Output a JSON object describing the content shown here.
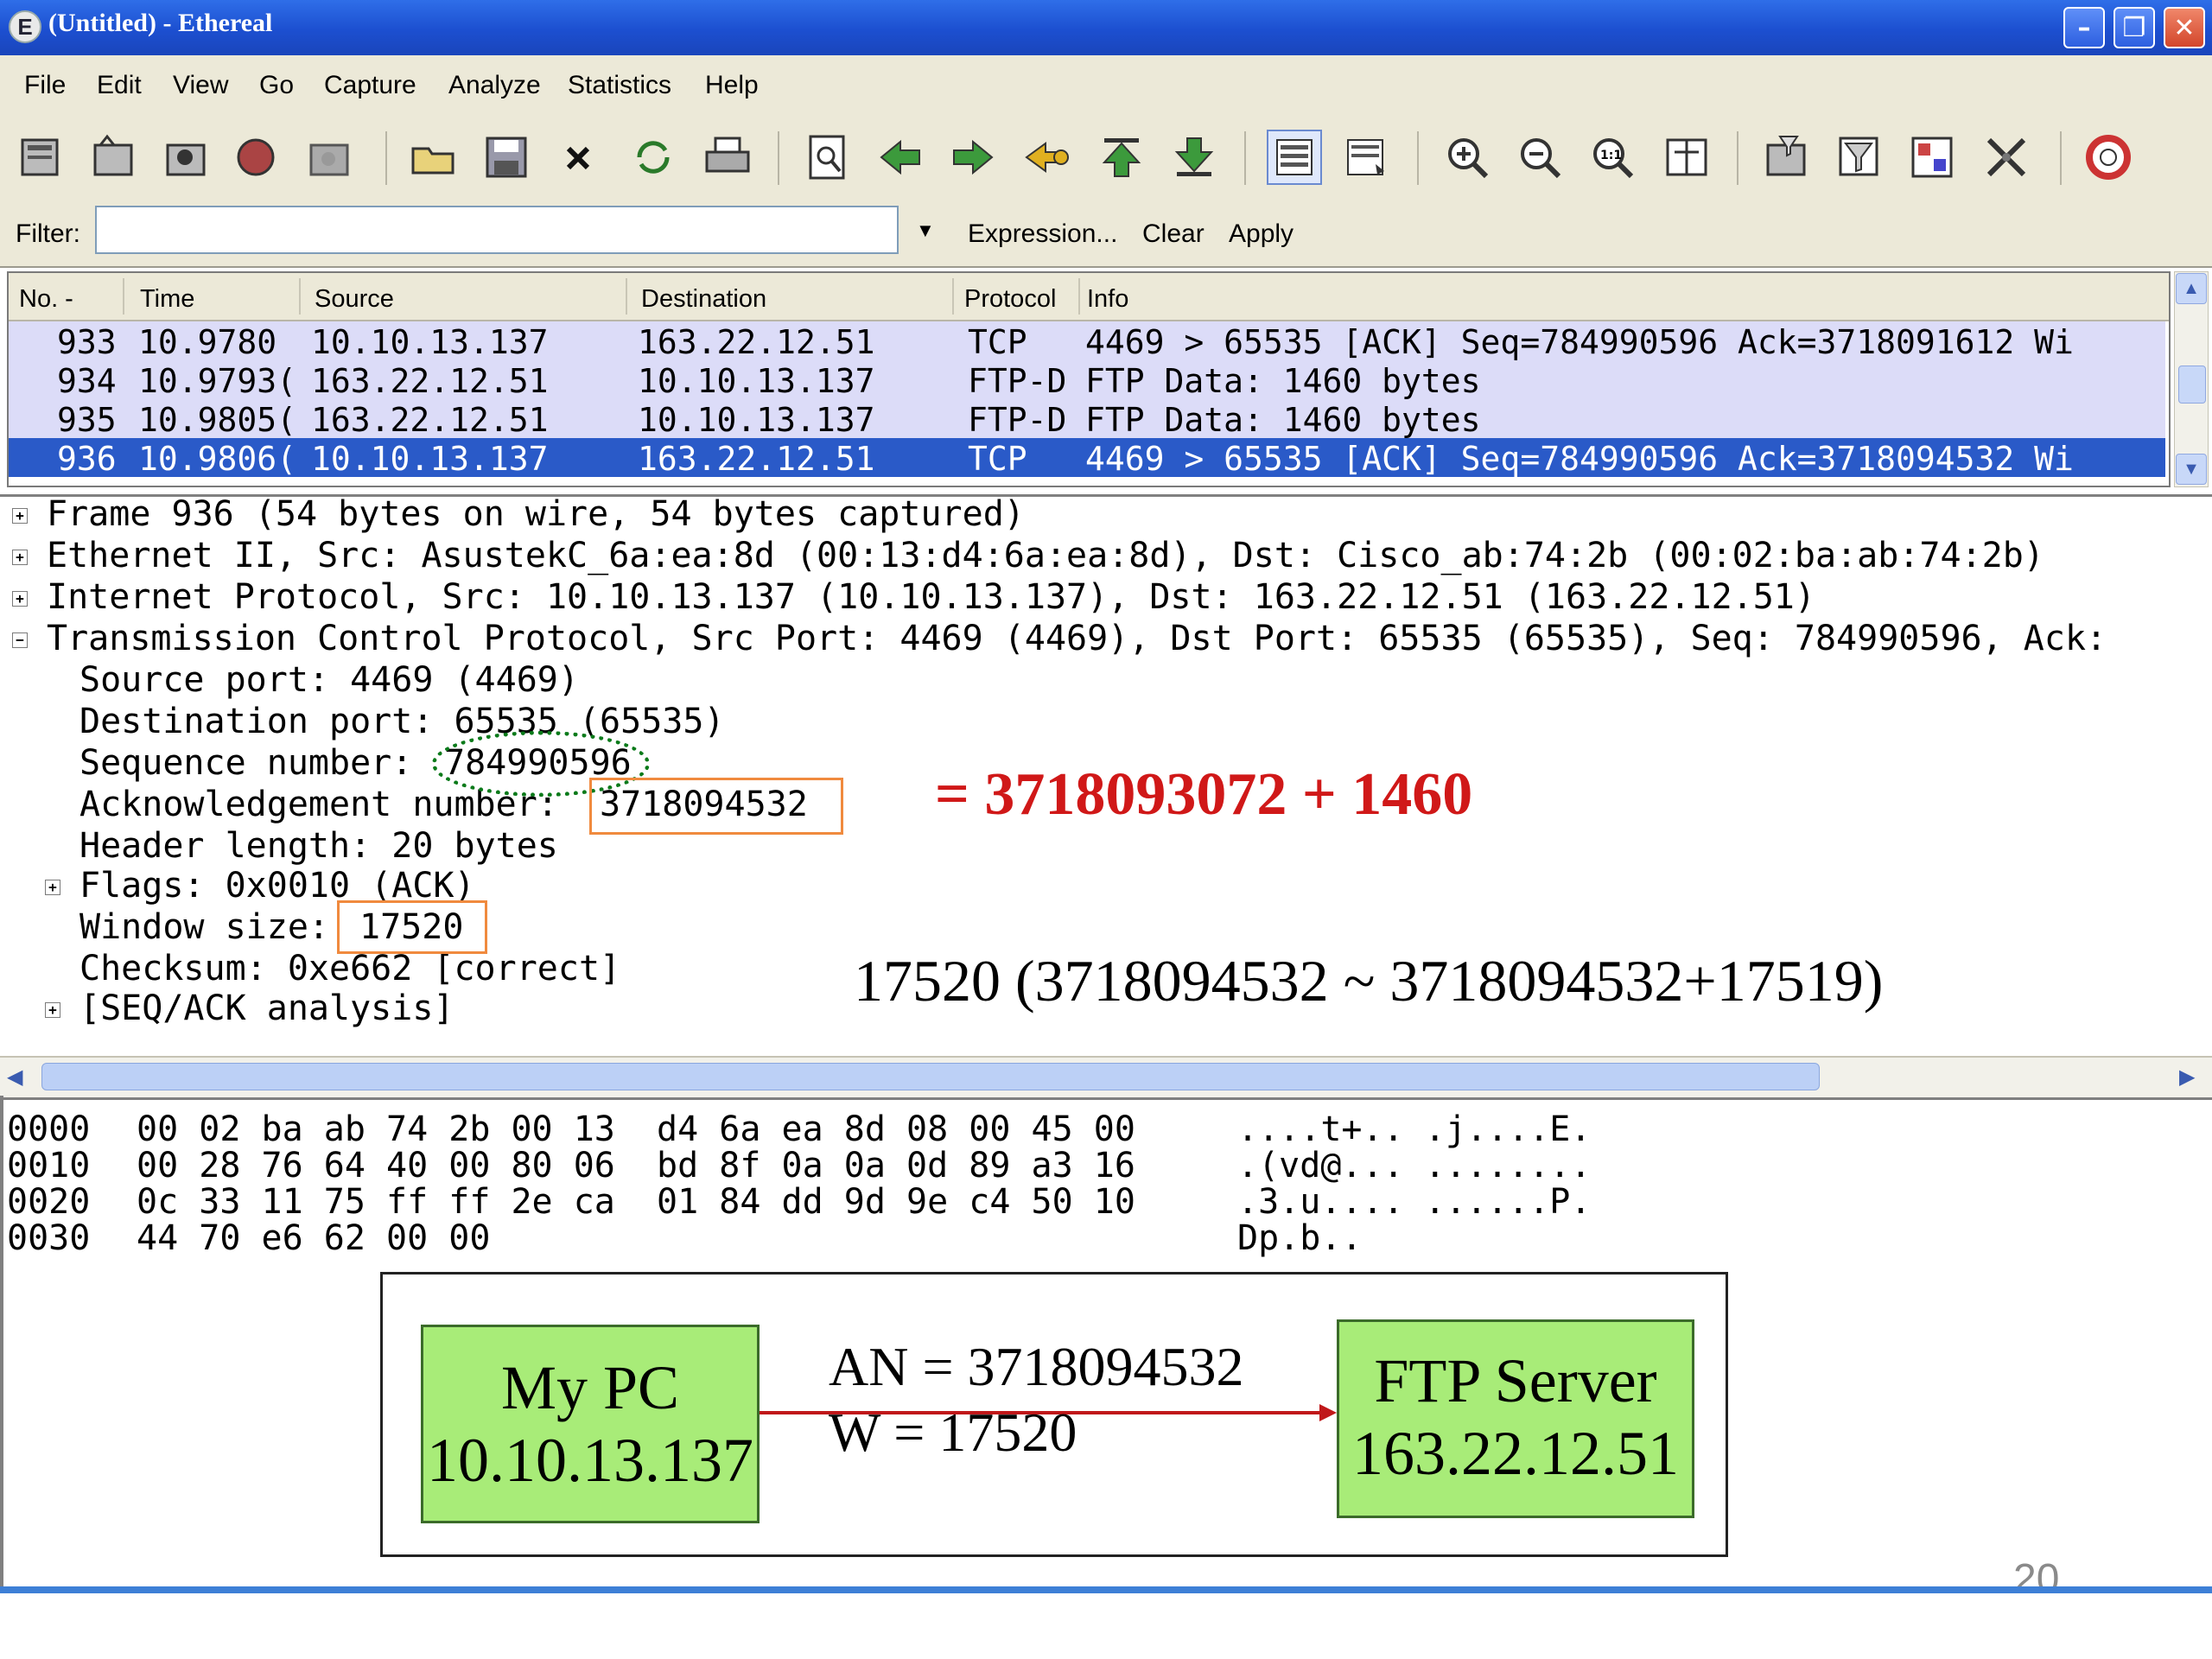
{
  "window": {
    "title": "(Untitled) - Ethereal",
    "app_icon": "E"
  },
  "menu": [
    "File",
    "Edit",
    "View",
    "Go",
    "Capture",
    "Analyze",
    "Statistics",
    "Help"
  ],
  "filter": {
    "label": "Filter:",
    "value": "",
    "expression": "Expression...",
    "clear": "Clear",
    "apply": "Apply"
  },
  "packet_list": {
    "columns": [
      "No. -",
      "Time",
      "Source",
      "Destination",
      "Protocol",
      "Info"
    ],
    "rows": [
      {
        "no": "933",
        "time": "10.9780",
        "source": "10.10.13.137",
        "destination": "163.22.12.51",
        "protocol": "TCP",
        "info": "4469 > 65535 [ACK] Seq=784990596 Ack=3718091612 Wi",
        "selected": false
      },
      {
        "no": "934",
        "time": "10.9793(",
        "source": "163.22.12.51",
        "destination": "10.10.13.137",
        "protocol": "FTP-D",
        "info": "FTP Data: 1460 bytes",
        "selected": false
      },
      {
        "no": "935",
        "time": "10.9805(",
        "source": "163.22.12.51",
        "destination": "10.10.13.137",
        "protocol": "FTP-D",
        "info": "FTP Data: 1460 bytes",
        "selected": false
      },
      {
        "no": "936",
        "time": "10.9806(",
        "source": "10.10.13.137",
        "destination": "163.22.12.51",
        "protocol": "TCP",
        "info": "4469 > 65535 [ACK] Seq=784990596 Ack=3718094532 Wi",
        "selected": true
      }
    ]
  },
  "details": {
    "frame": "Frame 936 (54 bytes on wire, 54 bytes captured)",
    "ethernet": "Ethernet II, Src: AsustekC_6a:ea:8d (00:13:d4:6a:ea:8d), Dst: Cisco_ab:74:2b (00:02:ba:ab:74:2b)",
    "ip": "Internet Protocol, Src: 10.10.13.137 (10.10.13.137), Dst: 163.22.12.51 (163.22.12.51)",
    "tcp": "Transmission Control Protocol, Src Port: 4469 (4469), Dst Port: 65535 (65535), Seq: 784990596, Ack:",
    "src_port": "Source port: 4469 (4469)",
    "dst_port": "Destination port: 65535 (65535)",
    "seq_label": "Sequence number:",
    "seq_value": "784990596",
    "ack_label": "Acknowledgement number:",
    "ack_value": "3718094532",
    "header_len": "Header length: 20 bytes",
    "flags": "Flags: 0x0010 (ACK)",
    "win_label": "Window size:",
    "win_value": "17520",
    "checksum": "Checksum: 0xe662 [correct]",
    "seq_ack": "[SEQ/ACK analysis]"
  },
  "annotations": {
    "ack_sum": "= 3718093072 + 1460",
    "window_range": "17520 (3718094532 ~ 3718094532+17519)"
  },
  "hex": [
    {
      "offset": "0000",
      "bytes": "00 02 ba ab 74 2b 00 13  d4 6a ea 8d 08 00 45 00",
      "ascii": "....t+.. .j....E."
    },
    {
      "offset": "0010",
      "bytes": "00 28 76 64 40 00 80 06  bd 8f 0a 0a 0d 89 a3 16",
      "ascii": ".(vd@... ........"
    },
    {
      "offset": "0020",
      "bytes": "0c 33 11 75 ff ff 2e ca  01 84 dd 9d 9e c4 50 10",
      "ascii": ".3.u.... ......P."
    },
    {
      "offset": "0030",
      "bytes": "44 70 e6 62 00 00",
      "ascii": "Dp.b.."
    }
  ],
  "diagram": {
    "left_node": {
      "line1": "My PC",
      "line2": "10.10.13.137"
    },
    "right_node": {
      "line1": "FTP Server",
      "line2": "163.22.12.51"
    },
    "an": "AN = 3718094532",
    "w": "W = 17520"
  },
  "page_number": "20",
  "colors": {
    "selection": "#2a5ac8",
    "row_bg": "#dcdcf8",
    "annot_red": "#d01818",
    "node_green": "#a8ec78",
    "orange_box": "#f08a3e",
    "dotted_green": "#0a7a1a"
  }
}
